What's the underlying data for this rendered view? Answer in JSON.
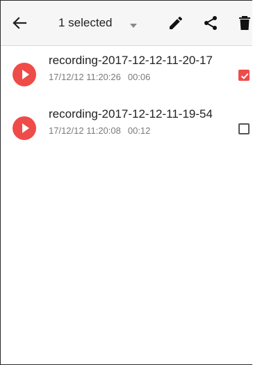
{
  "toolbar": {
    "title": "1 selected",
    "icons": [
      "back-arrow-icon",
      "dropdown-arrow-icon",
      "pencil-icon",
      "share-icon",
      "trash-icon"
    ]
  },
  "recordings": [
    {
      "name": "recording-2017-12-12-11-20-17",
      "date": "17/12/12 11:20:26",
      "duration": "00:06",
      "selected": true
    },
    {
      "name": "recording-2017-12-12-11-19-54",
      "date": "17/12/12 11:20:08",
      "duration": "00:12",
      "selected": false
    }
  ],
  "colors": {
    "accent": "#ef4b48",
    "toolbar_bg": "#f6f6f6",
    "meta_text": "#7a7a7a"
  }
}
